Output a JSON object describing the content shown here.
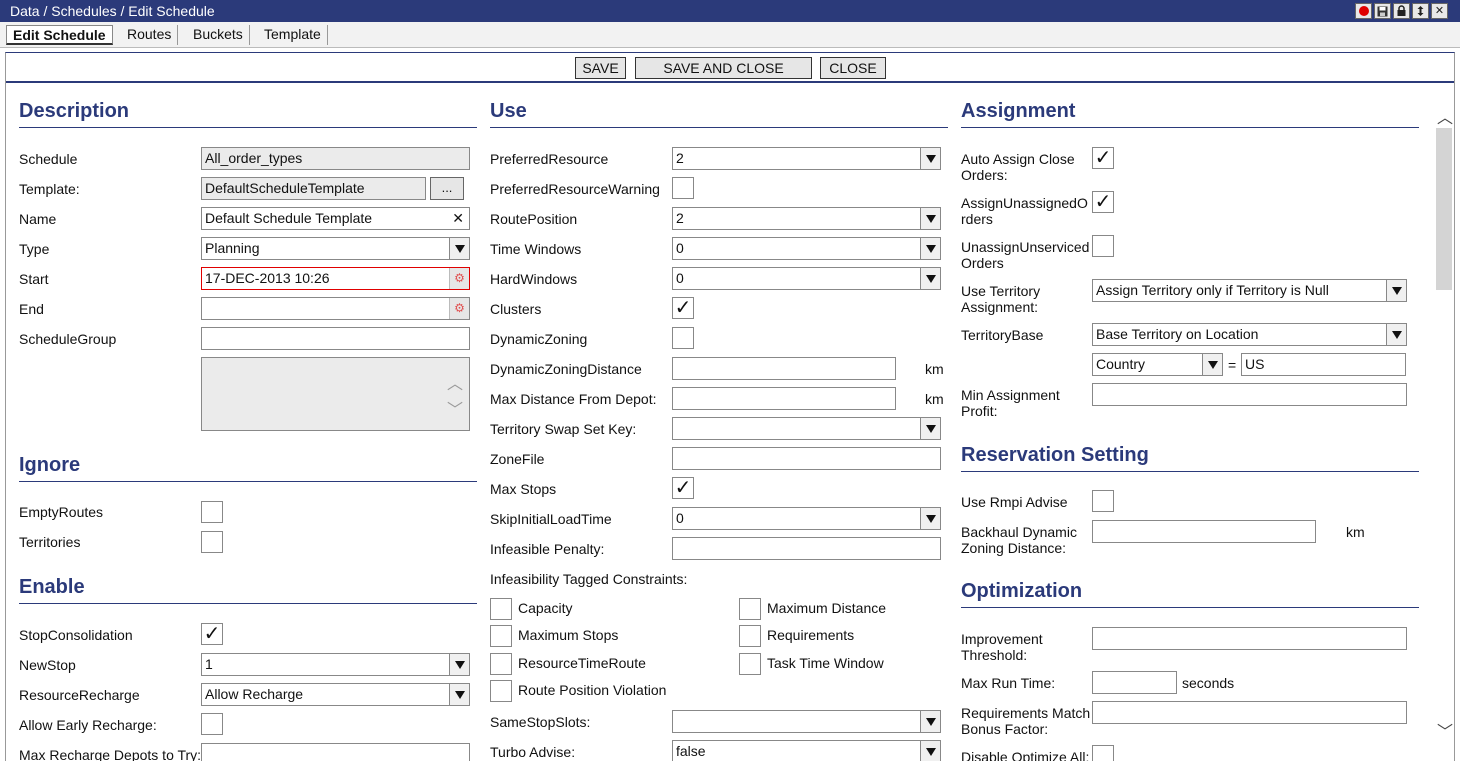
{
  "window": {
    "title": "Data / Schedules / Edit Schedule",
    "icons": [
      "record-icon",
      "save-icon",
      "lock-icon",
      "refresh-icon",
      "close-icon"
    ],
    "close_glyph": "✕"
  },
  "tabs": [
    "Edit Schedule",
    "Routes",
    "Buckets",
    "Template"
  ],
  "actions": {
    "save": "SAVE",
    "save_close": "SAVE AND CLOSE",
    "close": "CLOSE"
  },
  "description": {
    "heading": "Description",
    "schedule_label": "Schedule",
    "schedule_value": "All_order_types",
    "template_label": "Template:",
    "template_value": "DefaultScheduleTemplate",
    "template_browse": "...",
    "name_label": "Name",
    "name_value": "Default Schedule Template",
    "type_label": "Type",
    "type_value": "Planning",
    "start_label": "Start",
    "start_value": "17-DEC-2013 10:26",
    "end_label": "End",
    "end_value": "",
    "group_label": "ScheduleGroup",
    "group_value": ""
  },
  "ignore": {
    "heading": "Ignore",
    "empty_routes": "EmptyRoutes",
    "empty_routes_checked": false,
    "territories": "Territories",
    "territories_checked": false
  },
  "enable": {
    "heading": "Enable",
    "stop_consolidation": "StopConsolidation",
    "stop_consolidation_checked": true,
    "new_stop_label": "NewStop",
    "new_stop_value": "1",
    "recharge_label": "ResourceRecharge",
    "recharge_value": "Allow Recharge",
    "early_recharge_label": "Allow Early Recharge:",
    "early_recharge_checked": false,
    "max_depots_label": "Max Recharge Depots to Try:"
  },
  "use": {
    "heading": "Use",
    "preferred_resource_label": "PreferredResource",
    "preferred_resource_value": "2",
    "preferred_warning_label": "PreferredResourceWarning",
    "preferred_warning_checked": false,
    "route_position_label": "RoutePosition",
    "route_position_value": "2",
    "time_windows_label": "Time Windows",
    "time_windows_value": "0",
    "hard_windows_label": "HardWindows",
    "hard_windows_value": "0",
    "clusters_label": "Clusters",
    "clusters_checked": true,
    "dynamic_zoning_label": "DynamicZoning",
    "dynamic_zoning_checked": false,
    "dz_distance_label": "DynamicZoningDistance",
    "dz_distance_unit": "km",
    "max_dist_label": "Max Distance From Depot:",
    "max_dist_unit": "km",
    "swap_set_label": "Territory Swap Set Key:",
    "zone_file_label": "ZoneFile",
    "max_stops_label": "Max Stops",
    "max_stops_checked": true,
    "skip_load_label": "SkipInitialLoadTime",
    "skip_load_value": "0",
    "infeasible_penalty_label": "Infeasible Penalty:",
    "constraints_label": "Infeasibility Tagged Constraints:",
    "constraints": [
      "Capacity",
      "Maximum Distance",
      "Maximum Stops",
      "Requirements",
      "ResourceTimeRoute",
      "Task Time Window",
      "Route Position Violation"
    ],
    "same_stop_label": "SameStopSlots:",
    "turbo_label": "Turbo Advise:",
    "turbo_value": "false"
  },
  "assignment": {
    "heading": "Assignment",
    "auto_assign_label": "Auto Assign Close Orders:",
    "auto_assign_checked": true,
    "assign_unassigned_label": "AssignUnassignedOrders",
    "assign_unassigned_checked": true,
    "unassign_label": "UnassignUnservicedOrders",
    "unassign_checked": false,
    "use_territory_label": "Use Territory Assignment:",
    "use_territory_value": "Assign Territory only if Territory is Null",
    "territory_base_label": "TerritoryBase",
    "territory_base_value": "Base Territory on Location",
    "country_value": "Country",
    "equals": "=",
    "country_code": "US",
    "min_profit_label": "Min Assignment Profit:"
  },
  "reservation": {
    "heading": "Reservation Setting",
    "rmpi_label": "Use Rmpi Advise",
    "rmpi_checked": false,
    "backhaul_label": "Backhaul Dynamic Zoning Distance:",
    "backhaul_unit": "km"
  },
  "optimization": {
    "heading": "Optimization",
    "improvement_label": "Improvement Threshold:",
    "max_run_label": "Max Run Time:",
    "max_run_unit": "seconds",
    "req_match_label": "Requirements Match Bonus Factor:",
    "disable_label": "Disable Optimize All:"
  }
}
